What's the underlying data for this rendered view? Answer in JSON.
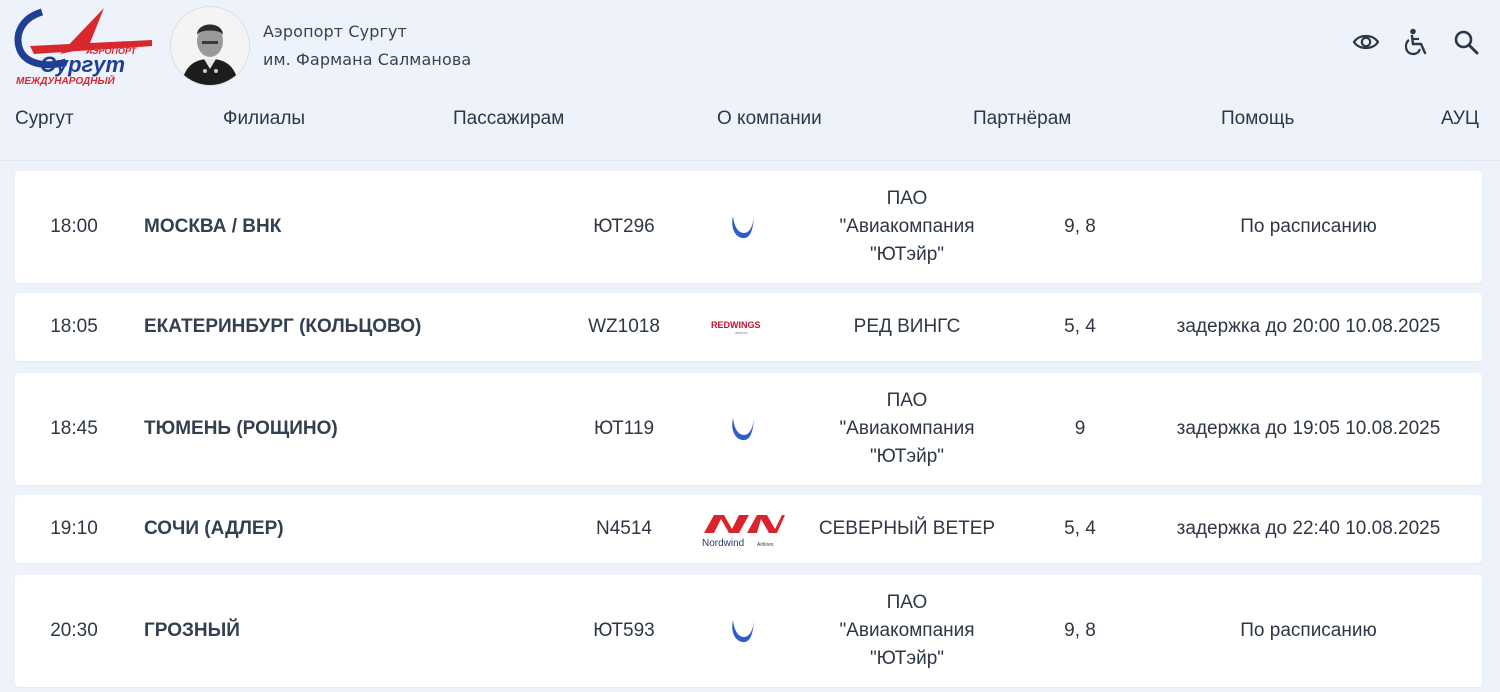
{
  "header": {
    "logo": {
      "icon": "surgut-airport-logo",
      "text_top": "АЭРОПОРТ",
      "text_main": "Сургут",
      "text_bottom": "МЕЖДУНАРОДНЫЙ"
    },
    "portrait": {
      "icon": "farman-salmanov-portrait"
    },
    "org_name_line1": "Аэропорт Сургут",
    "org_name_line2": "им. Фармана Салманова",
    "tools": [
      {
        "icon": "eye-icon"
      },
      {
        "icon": "accessibility-icon"
      },
      {
        "icon": "search-icon"
      }
    ]
  },
  "nav": [
    {
      "label": "Сургут"
    },
    {
      "label": "Филиалы"
    },
    {
      "label": "Пассажирам"
    },
    {
      "label": "О компании"
    },
    {
      "label": "Партнёрам"
    },
    {
      "label": "Помощь"
    },
    {
      "label": "АУЦ"
    }
  ],
  "flights": [
    {
      "time": "18:00",
      "destination": "МОСКВА / ВНК",
      "flight": "ЮТ296",
      "carrier_logo": "utair-logo",
      "airline": [
        "ПАО",
        "\"Авиакомпания",
        "\"ЮТэйр\""
      ],
      "gates": "9, 8",
      "status": "По расписанию"
    },
    {
      "time": "18:05",
      "destination": "ЕКАТЕРИНБУРГ (КОЛЬЦОВО)",
      "flight": "WZ1018",
      "carrier_logo": "red-wings-logo",
      "airline": [
        "РЕД ВИНГС"
      ],
      "gates": "5, 4",
      "status": "задержка до 20:00 10.08.2025"
    },
    {
      "time": "18:45",
      "destination": "ТЮМЕНЬ (РОЩИНО)",
      "flight": "ЮТ119",
      "carrier_logo": "utair-logo",
      "airline": [
        "ПАО",
        "\"Авиакомпания",
        "\"ЮТэйр\""
      ],
      "gates": "9",
      "status": "задержка до 19:05 10.08.2025"
    },
    {
      "time": "19:10",
      "destination": "СОЧИ (АДЛЕР)",
      "flight": "N4514",
      "carrier_logo": "nordwind-logo",
      "airline": [
        "СЕВЕРНЫЙ ВЕТЕР"
      ],
      "gates": "5, 4",
      "status": "задержка до 22:40 10.08.2025"
    },
    {
      "time": "20:30",
      "destination": "ГРОЗНЫЙ",
      "flight": "ЮТ593",
      "carrier_logo": "utair-logo",
      "airline": [
        "ПАО",
        "\"Авиакомпания",
        "\"ЮТэйр\""
      ],
      "gates": "9, 8",
      "status": "По расписанию"
    }
  ],
  "logo_texts": {
    "red_wings": "REDWINGS",
    "red_wings_sub": "airlines",
    "nordwind": "Nordwind",
    "nordwind_sub": "Airlines"
  },
  "colors": {
    "brand_red": "#d8282e",
    "brand_blue": "#1f3f95",
    "background": "#eef3fb",
    "row": "#ffffff",
    "utair_blue": "#2f5dc9",
    "nordwind_red": "#d9232d"
  }
}
